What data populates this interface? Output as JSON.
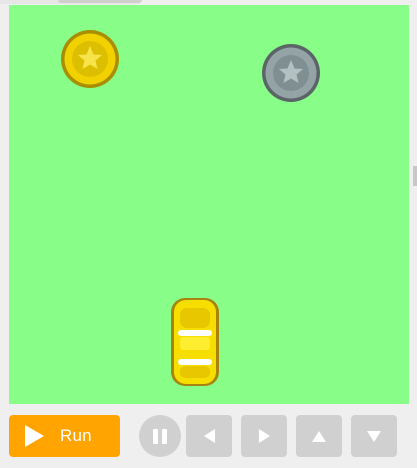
{
  "game": {
    "background_color": "#88fd88",
    "sprites": [
      {
        "name": "coin-gold",
        "kind": "coin",
        "color": "#f2d100"
      },
      {
        "name": "coin-silver",
        "kind": "coin",
        "color": "#93a3a6"
      },
      {
        "name": "car",
        "kind": "player-car",
        "color": "#f6df00"
      }
    ]
  },
  "controls": {
    "run_label": "Run",
    "run_color": "#ffa400",
    "button_color": "#d0d0d0",
    "icons": [
      "play-icon",
      "pause-icon",
      "arrow-left-icon",
      "arrow-right-icon",
      "arrow-up-icon",
      "arrow-down-icon"
    ]
  }
}
